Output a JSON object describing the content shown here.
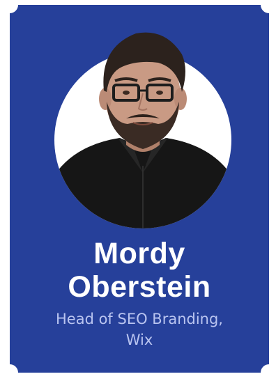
{
  "profile": {
    "name_line1": "Mordy",
    "name_line2": "Oberstein",
    "title_line1": "Head of SEO Branding,",
    "title_line2": "Wix",
    "photo_icon": "person-portrait",
    "colors": {
      "card": "#26409a",
      "name": "#ffffff",
      "title": "#b9c4f0"
    }
  }
}
